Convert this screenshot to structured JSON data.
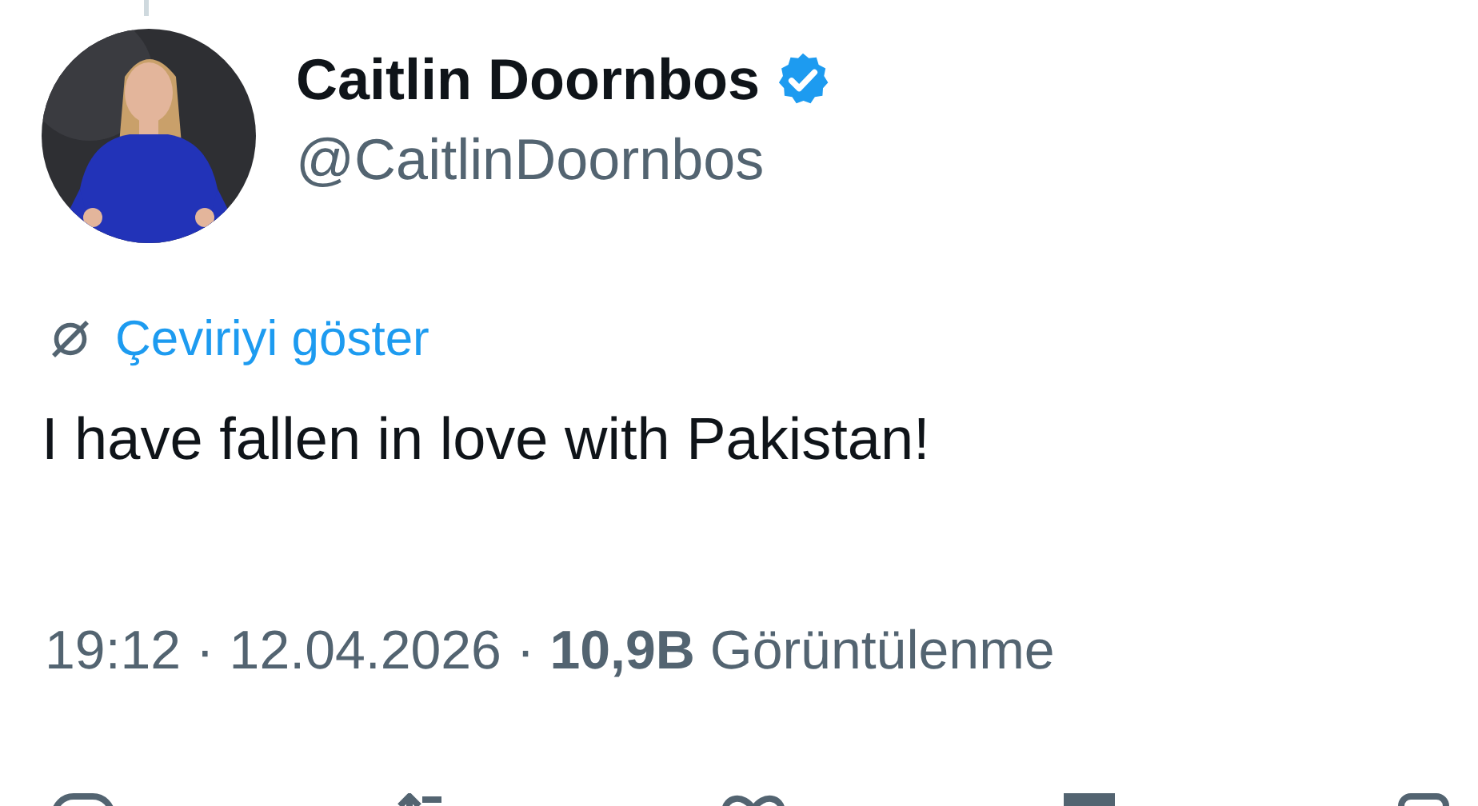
{
  "author": {
    "name": "Caitlin Doornbos",
    "verified": true,
    "handle": "@CaitlinDoornbos"
  },
  "translate_link": "Çeviriyi göster",
  "tweet_text": "I have fallen in love with Pakistan!",
  "meta": "19:12 · 12.04.2026 · **10,9B** Görüntülenme"
}
